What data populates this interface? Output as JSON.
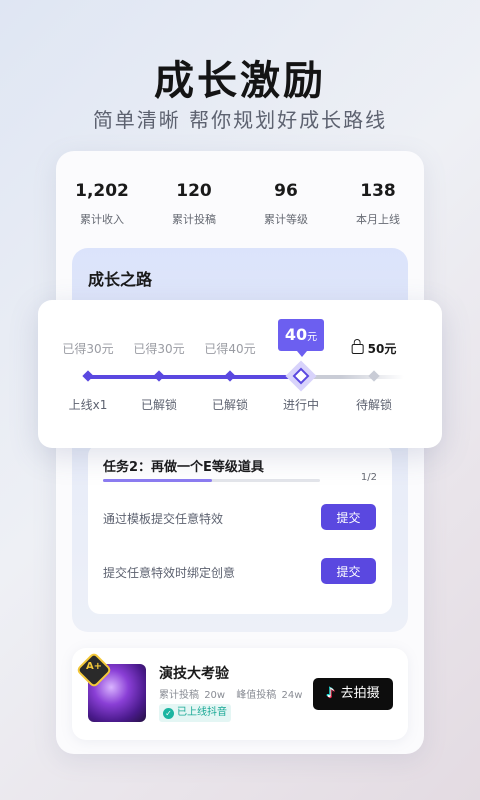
{
  "hero": {
    "title": "成长激励",
    "subtitle": "简单清晰 帮你规划好成长路线"
  },
  "stats": [
    {
      "value": "1,202",
      "label": "累计收入"
    },
    {
      "value": "120",
      "label": "累计投稿"
    },
    {
      "value": "96",
      "label": "累计等级"
    },
    {
      "value": "138",
      "label": "本月上线"
    }
  ],
  "growth_road": {
    "title": "成长之路",
    "rewards": [
      "已得30元",
      "已得30元",
      "已得40元",
      "",
      "50元"
    ],
    "current_reward": {
      "value": "40",
      "unit": "元"
    },
    "steps": [
      "上线x1",
      "已解锁",
      "已解锁",
      "进行中",
      "待解锁"
    ],
    "icons": [
      "lock-icon"
    ]
  },
  "task": {
    "title": "任务2：再做一个E等级道具",
    "progress": "1/2",
    "progress_fraction": 0.5,
    "items": [
      {
        "text": "通过模板提交任意特效",
        "button": "提交"
      },
      {
        "text": "提交任意特效时绑定创意",
        "button": "提交"
      }
    ]
  },
  "challenge": {
    "grade": "A+",
    "title": "演技大考验",
    "meta_label_1": "累计投稿",
    "meta_value_1": "20w",
    "meta_label_2": "峰值投稿",
    "meta_value_2": "24w",
    "status": "已上线抖音",
    "button": "去拍摄"
  },
  "colors": {
    "accent": "#5a48e0",
    "status": "#18a895",
    "grade": "#f3c83a"
  }
}
